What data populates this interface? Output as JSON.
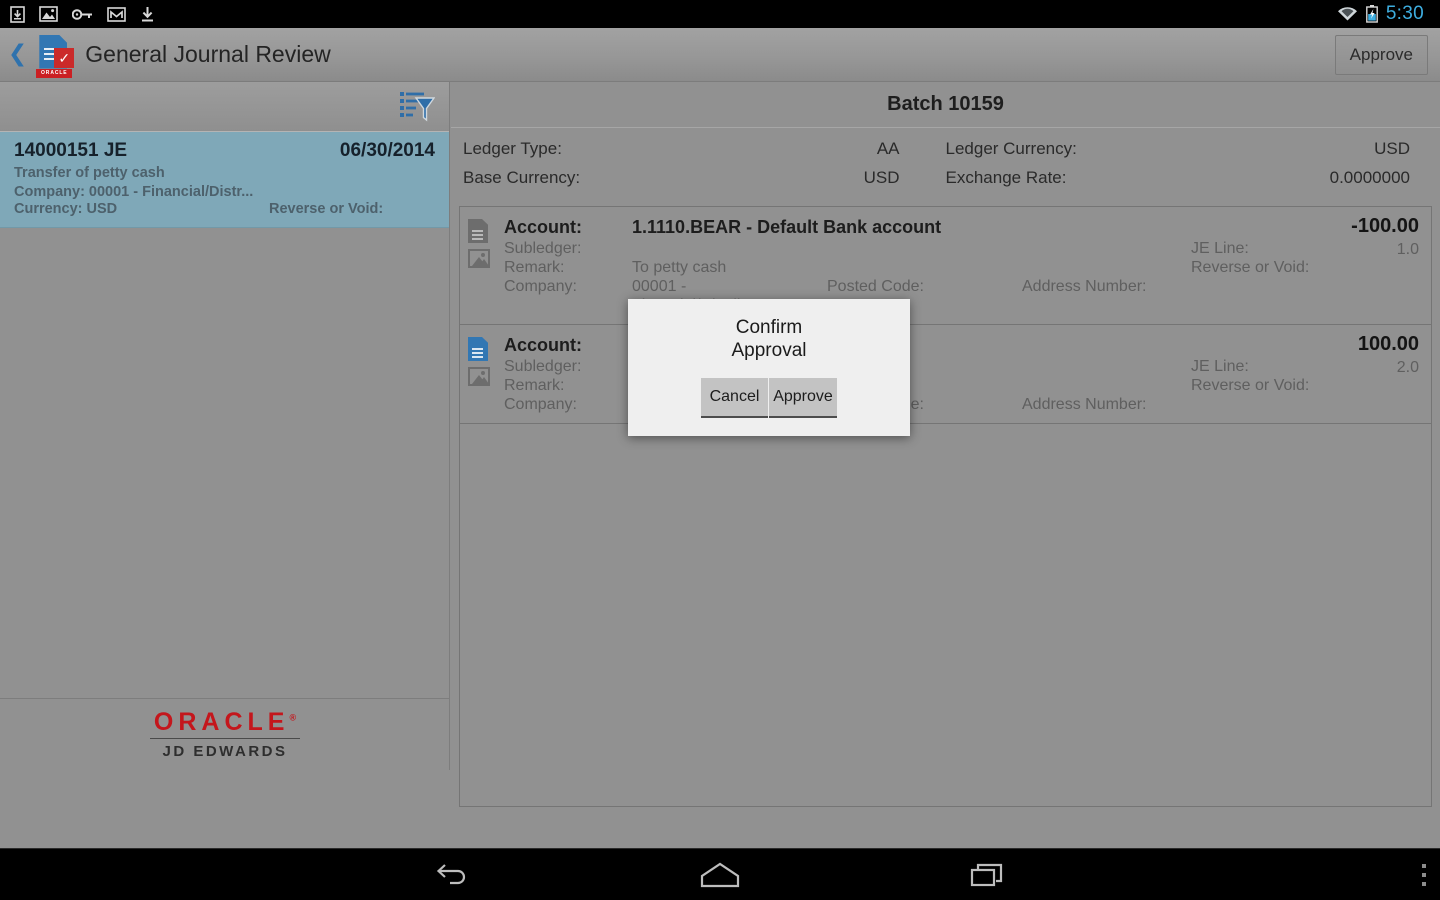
{
  "status_bar": {
    "icons": [
      "download-box-icon",
      "image-icon",
      "key-icon",
      "mail-icon",
      "download-arrow-icon"
    ],
    "wifi_icon": "wifi-icon",
    "battery_icon": "battery-charging-icon",
    "clock": "5:30",
    "clock_color": "#3eaee0"
  },
  "action_bar": {
    "back_icon": "back-chevron-icon",
    "app_icon": "jde-document-approval-icon",
    "app_icon_brand": "ORACLE",
    "title": "General Journal Review",
    "approve_label": "Approve"
  },
  "sidebar": {
    "filter_icon": "list-filter-icon",
    "items": [
      {
        "id": "14000151 JE",
        "date": "06/30/2014",
        "description": "Transfer of petty cash",
        "company": "Company: 00001 - Financial/Distr...",
        "currency": "Currency: USD",
        "reverse_or_void": "Reverse or Void:",
        "selected": true,
        "selected_color": "#7fa8b8"
      }
    ],
    "footer": {
      "brand": "ORACLE",
      "brand_mark": "®",
      "product": "JD EDWARDS",
      "brand_color": "#c4161c"
    }
  },
  "detail": {
    "batch_title": "Batch 10159",
    "meta": [
      {
        "label": "Ledger Type:",
        "value": "AA",
        "label2": "Ledger Currency:",
        "value2": "USD"
      },
      {
        "label": "Base Currency:",
        "value": "USD",
        "label2": "Exchange Rate:",
        "value2": "0.0000000"
      }
    ],
    "lines": [
      {
        "doc_icon": "document-icon",
        "doc_icon_color": "#6d6d6d",
        "image_icon": "image-attachment-icon",
        "account_label": "Account:",
        "account_value": "1.1110.BEAR - Default Bank account",
        "subledger_label": "Subledger:",
        "subledger_value": "",
        "remark_label": "Remark:",
        "remark_value": "To petty cash",
        "company_label": "Company:",
        "company_value": "00001 - Financial/Distribut...",
        "posted_code_label": "Posted Code:",
        "posted_code_value": "",
        "je_line_label": "JE Line:",
        "je_line_value": "1.0",
        "reverse_or_void_label": "Reverse or Void:",
        "reverse_or_void_value": "",
        "address_number_label": "Address Number:",
        "address_number_value": "",
        "amount": "-100.00"
      },
      {
        "doc_icon": "document-icon",
        "doc_icon_color": "#3277b3",
        "image_icon": "image-attachment-icon",
        "account_label": "Account:",
        "account_value": "",
        "subledger_label": "Subledger:",
        "subledger_value": "",
        "remark_label": "Remark:",
        "remark_value": "",
        "company_label": "Company:",
        "company_value": "",
        "posted_code_label": "Posted Code:",
        "posted_code_value": "",
        "je_line_label": "JE Line:",
        "je_line_value": "2.0",
        "reverse_or_void_label": "Reverse or Void:",
        "reverse_or_void_value": "",
        "address_number_label": "Address Number:",
        "address_number_value": "",
        "amount": "100.00"
      }
    ]
  },
  "dialog": {
    "title_line1": "Confirm",
    "title_line2": "Approval",
    "cancel_label": "Cancel",
    "approve_label": "Approve"
  },
  "nav_bar": {
    "back_icon": "nav-back-icon",
    "home_icon": "nav-home-icon",
    "recents_icon": "nav-recents-icon",
    "overflow_icon": "nav-overflow-icon"
  }
}
